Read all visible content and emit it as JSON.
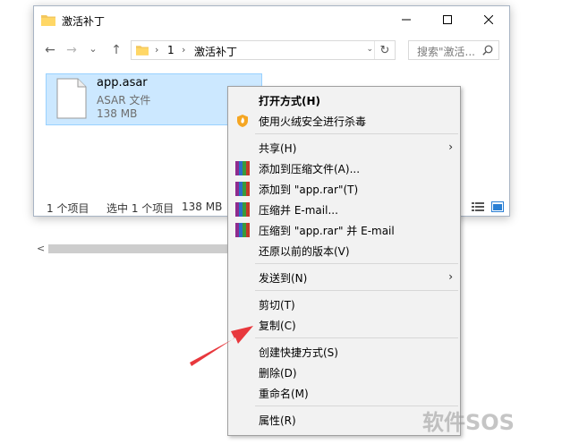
{
  "window": {
    "title": "激活补丁",
    "icons": {
      "folder": "folder-icon",
      "minimize": "minimize-icon",
      "maximize": "maximize-icon",
      "close": "close-icon"
    }
  },
  "nav": {
    "back": "←",
    "forward": "→",
    "recent": "⌄",
    "up": "↑",
    "breadcrumb": [
      "1",
      "激活补丁"
    ],
    "refresh": "↻",
    "search_placeholder": "搜索\"激活..."
  },
  "file": {
    "name": "app.asar",
    "type": "ASAR 文件",
    "size": "138 MB",
    "icon": "document-icon"
  },
  "statusbar": {
    "count": "1 个项目",
    "selected": "选中 1 个项目",
    "size": "138 MB"
  },
  "context_menu": {
    "items": [
      {
        "label": "打开方式(H)",
        "bold": true
      },
      {
        "label": "使用火绒安全进行杀毒",
        "icon": "huorong-shield-icon"
      },
      {
        "label": "共享(H)",
        "submenu": true
      },
      {
        "label": "添加到压缩文件(A)...",
        "icon": "winrar-icon"
      },
      {
        "label": "添加到 \"app.rar\"(T)",
        "icon": "winrar-icon"
      },
      {
        "label": "压缩并 E-mail...",
        "icon": "winrar-icon"
      },
      {
        "label": "压缩到 \"app.rar\" 并 E-mail",
        "icon": "winrar-icon"
      },
      {
        "label": "还原以前的版本(V)"
      },
      {
        "label": "发送到(N)",
        "submenu": true
      },
      {
        "label": "剪切(T)"
      },
      {
        "label": "复制(C)"
      },
      {
        "label": "创建快捷方式(S)"
      },
      {
        "label": "删除(D)"
      },
      {
        "label": "重命名(M)"
      },
      {
        "label": "属性(R)"
      }
    ],
    "submenu_arrow": "›"
  },
  "colors": {
    "selection": "#cce8ff",
    "menu_bg": "#f2f2f2",
    "annotation_arrow": "#e8383d"
  },
  "watermark": "软件SOS"
}
